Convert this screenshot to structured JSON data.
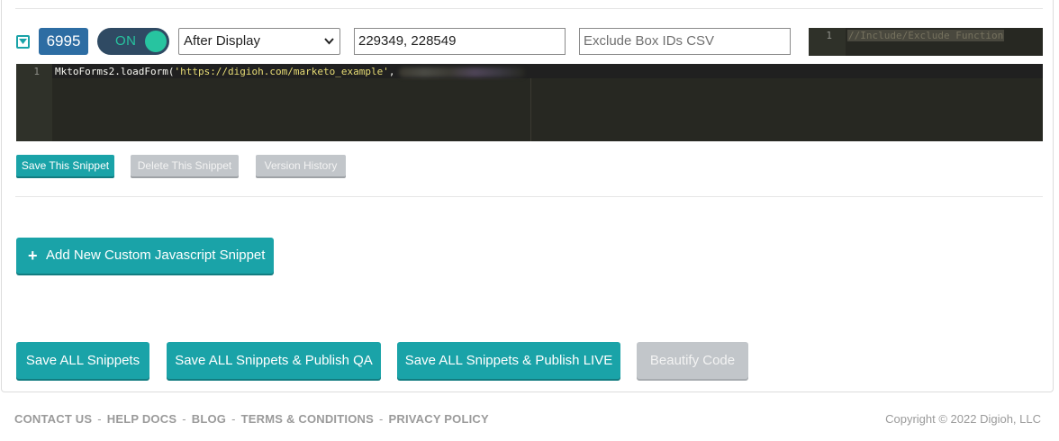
{
  "snippet": {
    "id": "6995",
    "toggle_label": "ON",
    "timing_select": "After Display",
    "include_box_ids": "229349, 228549",
    "exclude_box_ids_placeholder": "Exclude Box IDs CSV",
    "include_exclude_editor": {
      "line_number": "1",
      "code": "//Include/Exclude Function"
    },
    "code_editor": {
      "line_number": "1",
      "code_prefix": "MktoForms2.loadForm(",
      "code_string": "'https://digioh.com/marketo_example'",
      "code_suffix": ","
    },
    "buttons": {
      "save": "Save This Snippet",
      "delete": "Delete This Snippet",
      "version_history": "Version History"
    }
  },
  "add_button": {
    "icon": "plus-icon",
    "label": "Add New Custom Javascript Snippet"
  },
  "actions": {
    "save_all": "Save ALL Snippets",
    "save_qa": "Save ALL Snippets & Publish QA",
    "save_live": "Save ALL Snippets & Publish LIVE",
    "beautify": "Beautify Code"
  },
  "footer": {
    "links": [
      "CONTACT US",
      "HELP DOCS",
      "BLOG",
      "TERMS & CONDITIONS",
      "PRIVACY POLICY"
    ],
    "separator": "-",
    "copyright": "Copyright © 2022 Digioh, LLC"
  },
  "colors": {
    "teal": "#1aa3a8",
    "id_badge": "#2d6da3",
    "switch_bg": "#2f4a63",
    "switch_on": "#27c4a0",
    "editor_bg": "#272822",
    "disabled": "#c2c6ca"
  }
}
